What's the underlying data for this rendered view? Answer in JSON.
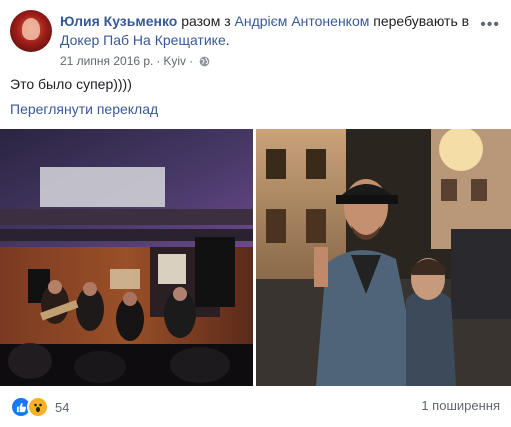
{
  "post": {
    "author": "Юлия Кузьменко",
    "with_word": "разом з",
    "companion": "Андрієм Антоненком",
    "at_word": "перебувають в",
    "place": "Докер Паб На Крещатике",
    "place_end": ".",
    "date": "21 липня 2016 р.",
    "separator": "·",
    "location": "Kyiv",
    "location_sep": "·",
    "privacy_icon": "globe-icon",
    "more_icon": "more-icon",
    "text": "Это было супер))))",
    "translate_link": "Переглянути переклад"
  },
  "footer": {
    "reaction_icons": [
      "like-icon",
      "wow-icon"
    ],
    "reaction_count": "54",
    "shares": "1 поширення"
  },
  "colors": {
    "link": "#385898",
    "text": "#1c1e21",
    "meta": "#616770",
    "like": "#1877f2",
    "wow": "#f7b125"
  }
}
